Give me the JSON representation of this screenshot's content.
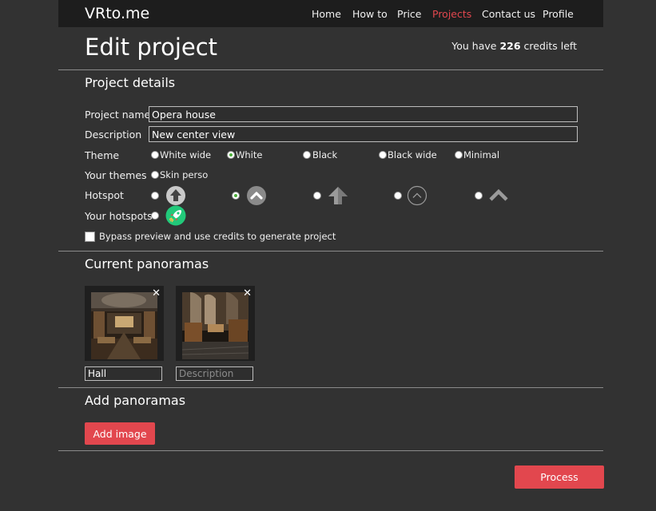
{
  "nav": {
    "brand": "VRto.me",
    "links": [
      {
        "label": "Home",
        "active": false
      },
      {
        "label": "How to",
        "active": false
      },
      {
        "label": "Price",
        "active": false
      },
      {
        "label": "Projects",
        "active": true
      },
      {
        "label": "Contact us",
        "active": false
      },
      {
        "label": "Profile",
        "active": false
      }
    ]
  },
  "header": {
    "title": "Edit project",
    "credits_prefix": "You have",
    "credits_value": "226",
    "credits_suffix": "credits left"
  },
  "details": {
    "title": "Project details",
    "project_name_label": "Project name",
    "project_name_value": "Opera house",
    "description_label": "Description",
    "description_value": "New center view",
    "theme_label": "Theme",
    "themes": [
      {
        "label": "White wide",
        "selected": false
      },
      {
        "label": "White",
        "selected": true
      },
      {
        "label": "Black",
        "selected": false
      },
      {
        "label": "Black wide",
        "selected": false
      },
      {
        "label": "Minimal",
        "selected": false
      }
    ],
    "your_themes_label": "Your themes",
    "your_themes": [
      {
        "label": "Skin perso",
        "selected": false
      }
    ],
    "hotspot_label": "Hotspot",
    "hotspots": [
      {
        "icon": "arrow-up-circle-icon",
        "selected": false
      },
      {
        "icon": "chevron-up-circle-icon",
        "selected": true
      },
      {
        "icon": "arrow-up-3d-icon",
        "selected": false
      },
      {
        "icon": "chevron-up-outline-icon",
        "selected": false
      },
      {
        "icon": "chevron-up-icon",
        "selected": false
      }
    ],
    "your_hotspots_label": "Your hotspots",
    "your_hotspots": [
      {
        "icon": "rocket-icon",
        "selected": false
      }
    ],
    "bypass_label": "Bypass preview and use credits to generate project"
  },
  "panoramas": {
    "title": "Current panoramas",
    "items": [
      {
        "name": "Hall",
        "placeholder": "Description",
        "thumb": "library-hall-image"
      },
      {
        "name": "",
        "placeholder": "Description",
        "thumb": "library-aisle-image"
      }
    ],
    "close_glyph": "✕"
  },
  "add": {
    "title": "Add panoramas",
    "button": "Add image"
  },
  "process_button": "Process",
  "colors": {
    "accent": "#e2474e",
    "background": "#323232",
    "navbar": "#1d1d1d",
    "radio_selected": "#4caf3a"
  }
}
